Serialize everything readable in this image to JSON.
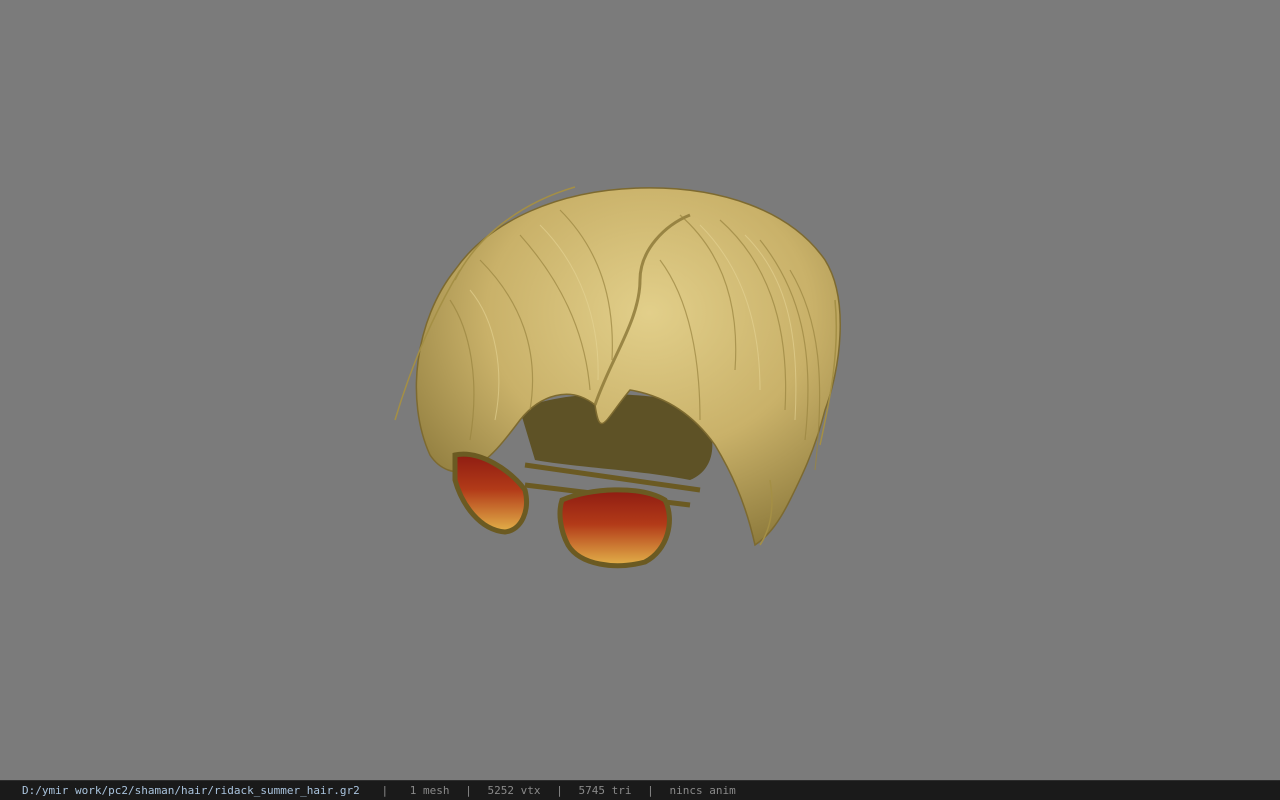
{
  "viewport": {
    "background": "#7b7b7b",
    "model_name": "hair"
  },
  "status_bar": {
    "file_path": "D:/ymir work/pc2/shaman/hair/ridack_summer_hair.gr2",
    "separator": "|",
    "mesh_count": "1 mesh",
    "vertex_count": "5252 vtx",
    "triangle_count": "5745 tri",
    "anim_status": "nincs anim",
    "path_color": "#a9c3dd",
    "text_color": "#8a8a8a"
  }
}
